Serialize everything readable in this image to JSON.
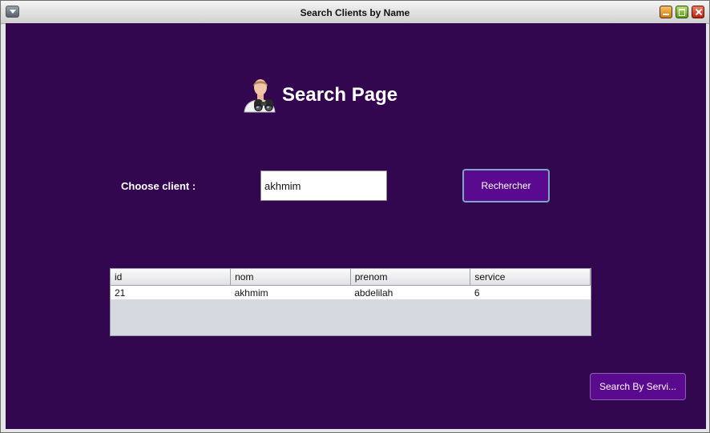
{
  "window": {
    "title": "Search Clients by Name"
  },
  "heading": {
    "title": "Search Page",
    "icon": "user-binoculars-icon"
  },
  "search": {
    "label": "Choose client :",
    "value": "akhmim",
    "button_label": "Rechercher"
  },
  "table": {
    "columns": [
      "id",
      "nom",
      "prenom",
      "service"
    ],
    "rows": [
      [
        "21",
        "akhmim",
        "abdelilah",
        "6"
      ]
    ]
  },
  "footer": {
    "service_button_label": "Search By Servi..."
  },
  "colors": {
    "background": "#330650",
    "button": "#5a0a8e"
  }
}
